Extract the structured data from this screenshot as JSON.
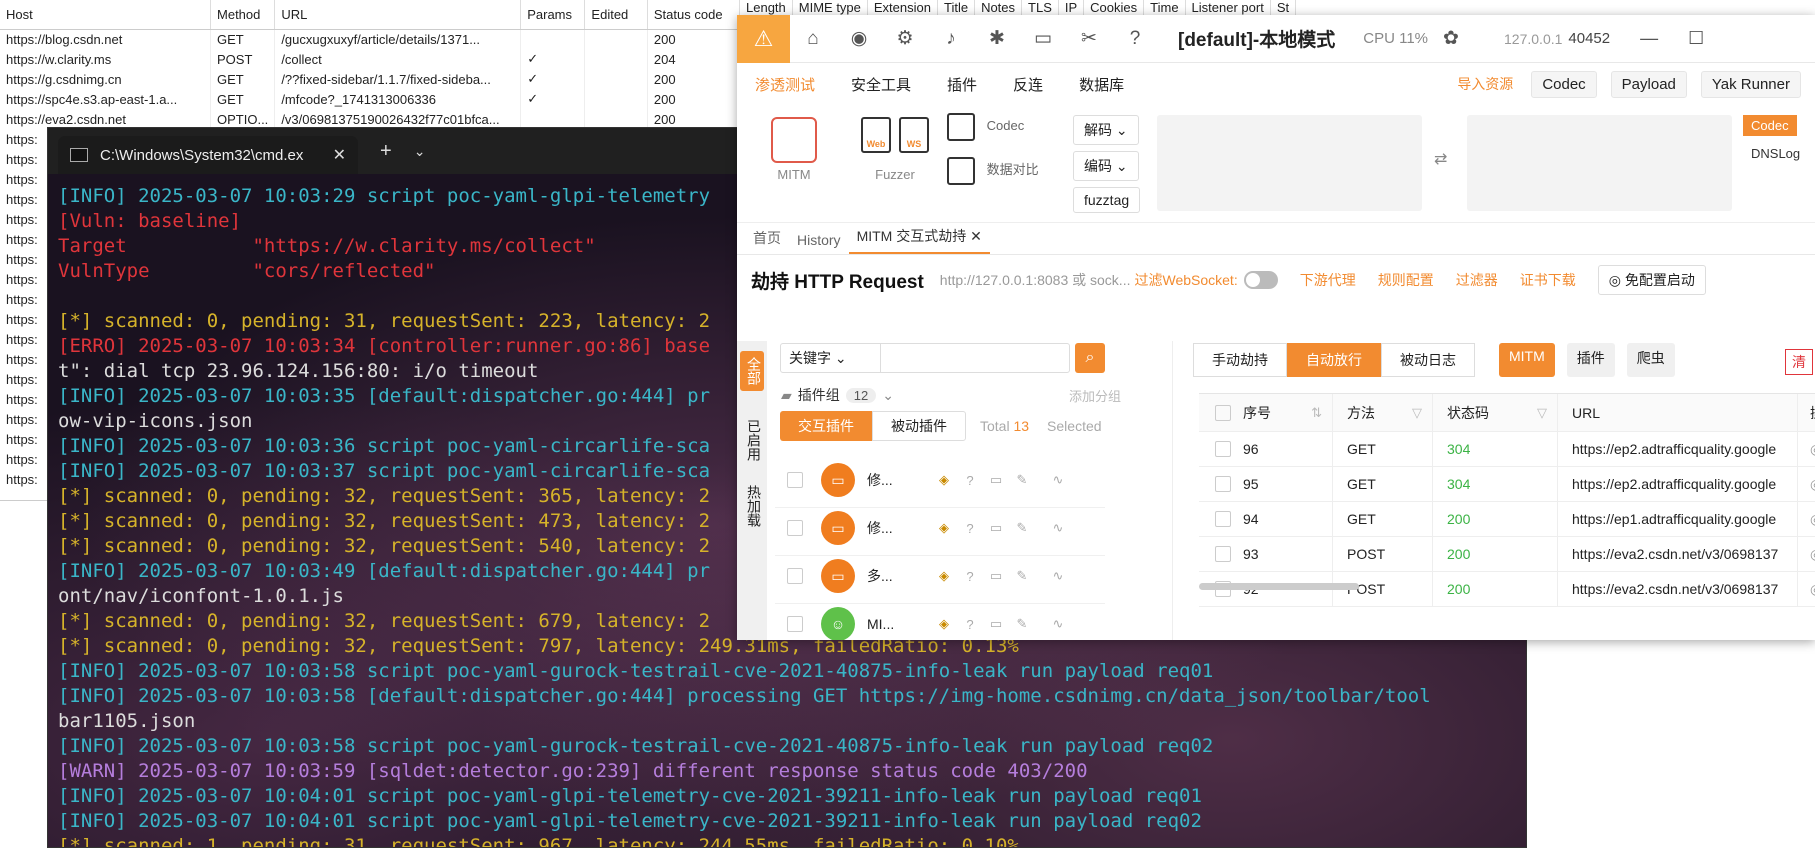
{
  "background_table": {
    "headers": [
      "Host",
      "Method",
      "URL",
      "Params",
      "Edited",
      "Status code",
      "Length",
      "MIME type",
      "Extension",
      "Title",
      "Notes",
      "TLS",
      "IP",
      "Cookies",
      "Time",
      "Listener port",
      "St"
    ],
    "rows": [
      {
        "host": "https://blog.csdn.net",
        "method": "GET",
        "url": "/gucxugxuxyf/article/details/1371...",
        "params": "",
        "status": "200"
      },
      {
        "host": "https://w.clarity.ms",
        "method": "POST",
        "url": "/collect",
        "params": "✓",
        "status": "204"
      },
      {
        "host": "https://g.csdnimg.cn",
        "method": "GET",
        "url": "/??fixed-sidebar/1.1.7/fixed-sideba...",
        "params": "✓",
        "status": "200"
      },
      {
        "host": "https://spc4e.s3.ap-east-1.a...",
        "method": "GET",
        "url": "/mfcode?_1741313006336",
        "params": "✓",
        "status": "200"
      },
      {
        "host": "https://eva2.csdn.net",
        "method": "OPTIO...",
        "url": "/v3/06981375190026432f77c01bfca...",
        "params": "",
        "status": "200"
      }
    ],
    "truncated_hosts": [
      "https:",
      "https:",
      "https:",
      "https:",
      "https:",
      "https:",
      "https:",
      "https:",
      "https:",
      "https:",
      "https:",
      "https:",
      "https:",
      "https:",
      "https:",
      "https:",
      "https:",
      "https:"
    ]
  },
  "cmd": {
    "tab_title": "C:\\Windows\\System32\\cmd.ex",
    "close": "✕",
    "new_tab": "+",
    "dropdown": "⌄",
    "lines": [
      {
        "cls": "c-info",
        "text": "[INFO] 2025-03-07 10:03:29 script poc-yaml-glpi-telemetry"
      },
      {
        "cls": "c-vuln",
        "text": "[Vuln: baseline]"
      },
      {
        "cls": "c-vuln",
        "text": "Target           \"https://w.clarity.ms/collect\""
      },
      {
        "cls": "c-vuln",
        "text": "VulnType         \"cors/reflected\""
      },
      {
        "cls": "",
        "text": " "
      },
      {
        "cls": "c-star",
        "text": "[*] scanned: 0, pending: 31, requestSent: 223, latency: 2"
      },
      {
        "cls": "c-erro",
        "text": "[ERRO] 2025-03-07 10:03:34 [controller:runner.go:86] base"
      },
      {
        "cls": "",
        "text": "t\": dial tcp 23.96.124.156:80: i/o timeout"
      },
      {
        "cls": "c-info",
        "text": "[INFO] 2025-03-07 10:03:35 [default:dispatcher.go:444] pr"
      },
      {
        "cls": "",
        "text": "ow-vip-icons.json"
      },
      {
        "cls": "c-info",
        "text": "[INFO] 2025-03-07 10:03:36 script poc-yaml-circarlife-sca"
      },
      {
        "cls": "c-info",
        "text": "[INFO] 2025-03-07 10:03:37 script poc-yaml-circarlife-sca"
      },
      {
        "cls": "c-star",
        "text": "[*] scanned: 0, pending: 32, requestSent: 365, latency: 2"
      },
      {
        "cls": "c-star",
        "text": "[*] scanned: 0, pending: 32, requestSent: 473, latency: 2"
      },
      {
        "cls": "c-star",
        "text": "[*] scanned: 0, pending: 32, requestSent: 540, latency: 2"
      },
      {
        "cls": "c-info",
        "text": "[INFO] 2025-03-07 10:03:49 [default:dispatcher.go:444] pr"
      },
      {
        "cls": "",
        "text": "ont/nav/iconfont-1.0.1.js"
      },
      {
        "cls": "c-star",
        "text": "[*] scanned: 0, pending: 32, requestSent: 679, latency: 2"
      },
      {
        "cls": "c-star",
        "text": "[*] scanned: 0, pending: 32, requestSent: 797, latency: 249.31ms, failedRatio: 0.13%"
      },
      {
        "cls": "c-info",
        "text": "[INFO] 2025-03-07 10:03:58 script poc-yaml-gurock-testrail-cve-2021-40875-info-leak run payload req01"
      },
      {
        "cls": "c-info",
        "text": "[INFO] 2025-03-07 10:03:58 [default:dispatcher.go:444] processing GET https://img-home.csdnimg.cn/data_json/toolbar/tool"
      },
      {
        "cls": "",
        "text": "bar1105.json"
      },
      {
        "cls": "c-info",
        "text": "[INFO] 2025-03-07 10:03:58 script poc-yaml-gurock-testrail-cve-2021-40875-info-leak run payload req02"
      },
      {
        "cls": "c-warn",
        "text": "[WARN] 2025-03-07 10:03:59 [sqldet:detector.go:239] different response status code 403/200"
      },
      {
        "cls": "c-info",
        "text": "[INFO] 2025-03-07 10:04:01 script poc-yaml-glpi-telemetry-cve-2021-39211-info-leak run payload req01"
      },
      {
        "cls": "c-info",
        "text": "[INFO] 2025-03-07 10:04:01 script poc-yaml-glpi-telemetry-cve-2021-39211-info-leak run payload req02"
      },
      {
        "cls": "c-star",
        "text": "[*] scanned: 1, pending: 31, requestSent: 967, latency: 244.55ms, failedRatio: 0.10%"
      }
    ]
  },
  "yak": {
    "title": {
      "mode": "[default]-本地模式",
      "cpu": "CPU 11%",
      "ip": "127.0.0.1",
      "port": "40452",
      "minimize": "—",
      "maximize": "☐"
    },
    "menu": {
      "items": [
        "渗透测试",
        "安全工具",
        "插件",
        "反连",
        "数据库"
      ],
      "import": "导入资源",
      "buttons": [
        "Codec",
        "Payload",
        "Yak Runner"
      ]
    },
    "tools": {
      "mitm": "MITM",
      "fuzzer": "Fuzzer",
      "codec": "Codec",
      "compare": "数据对比",
      "decode": "解码",
      "encode": "编码",
      "fuzztag": "fuzztag",
      "codec_btn": "Codec",
      "dnslog": "DNSLog",
      "web": "Web",
      "ws": "WS"
    },
    "tabs": [
      "首页",
      "History",
      "MITM 交互式劫持"
    ],
    "tab_close": "✕",
    "header": {
      "title": "劫持 HTTP Request",
      "sub": "http://127.0.0.1:8083 或 sock...",
      "ws": "过滤WebSocket:",
      "links": [
        "下游代理",
        "规则配置",
        "过滤器",
        "证书下载"
      ],
      "free": "免配置启动"
    },
    "side_tabs": [
      "全部",
      "已启用",
      "热加载"
    ],
    "plugins": {
      "keyword": "关键字",
      "group": "插件组",
      "group_count": "12",
      "add_group": "添加分组",
      "tab_active": "交互插件",
      "tab_passive": "被动插件",
      "total_label": "Total",
      "total": "13",
      "selected": "Selected",
      "rows": [
        {
          "name": "修...",
          "av": "▭"
        },
        {
          "name": "修...",
          "av": "▭"
        },
        {
          "name": "多...",
          "av": "▭"
        },
        {
          "name": "MI...",
          "av": "☺"
        }
      ]
    },
    "main": {
      "modes": [
        "手动劫持",
        "自动放行",
        "被动日志"
      ],
      "tags": [
        "MITM",
        "插件",
        "爬虫"
      ],
      "clear": "清",
      "columns": [
        "序号",
        "方法",
        "状态码",
        "URL",
        "操作"
      ],
      "rows": [
        {
          "id": "96",
          "method": "GET",
          "status": "304",
          "url": "https://ep2.adtrafficquality.google"
        },
        {
          "id": "95",
          "method": "GET",
          "status": "304",
          "url": "https://ep2.adtrafficquality.google"
        },
        {
          "id": "94",
          "method": "GET",
          "status": "200",
          "url": "https://ep1.adtrafficquality.google"
        },
        {
          "id": "93",
          "method": "POST",
          "status": "200",
          "url": "https://eva2.csdn.net/v3/0698137"
        },
        {
          "id": "92",
          "method": "POST",
          "status": "200",
          "url": "https://eva2.csdn.net/v3/0698137"
        }
      ]
    }
  },
  "colors": {
    "accent": "#f28b30",
    "info": "#3ab6c8",
    "error": "#e0353b",
    "warn_msg": "#d6b32a"
  }
}
